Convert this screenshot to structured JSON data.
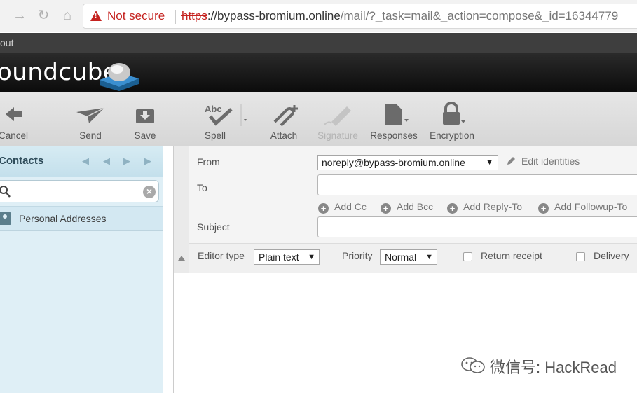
{
  "browser": {
    "security_label": "Not secure",
    "url_scheme": "https",
    "url_host": "://bypass-bromium.online",
    "url_path": "/mail/?_task=mail&_action=compose&_id=16344779"
  },
  "bookmark_strip": {
    "text": "out"
  },
  "app": {
    "logo_text": "oundcube"
  },
  "toolbar": {
    "cancel": "Cancel",
    "send": "Send",
    "save": "Save",
    "spell": "Spell",
    "attach": "Attach",
    "signature": "Signature",
    "responses": "Responses",
    "encryption": "Encryption"
  },
  "contacts": {
    "title": "Contacts",
    "search_value": "",
    "address_book": "Personal Addresses"
  },
  "compose": {
    "from_label": "From",
    "from_value": "noreply@bypass-bromium.online",
    "edit_identities": "Edit identities",
    "to_label": "To",
    "to_value": "",
    "add_cc": "Add Cc",
    "add_bcc": "Add Bcc",
    "add_reply_to": "Add Reply-To",
    "add_followup_to": "Add Followup-To",
    "subject_label": "Subject",
    "subject_value": ""
  },
  "options": {
    "editor_type_label": "Editor type",
    "editor_type_value": "Plain text",
    "priority_label": "Priority",
    "priority_value": "Normal",
    "return_receipt": "Return receipt",
    "delivery": "Delivery"
  },
  "watermark": {
    "text": "微信号: HackRead"
  },
  "colors": {
    "warning": "#c5221f",
    "panel": "#dfeff6",
    "header": "#0b0b0b"
  }
}
